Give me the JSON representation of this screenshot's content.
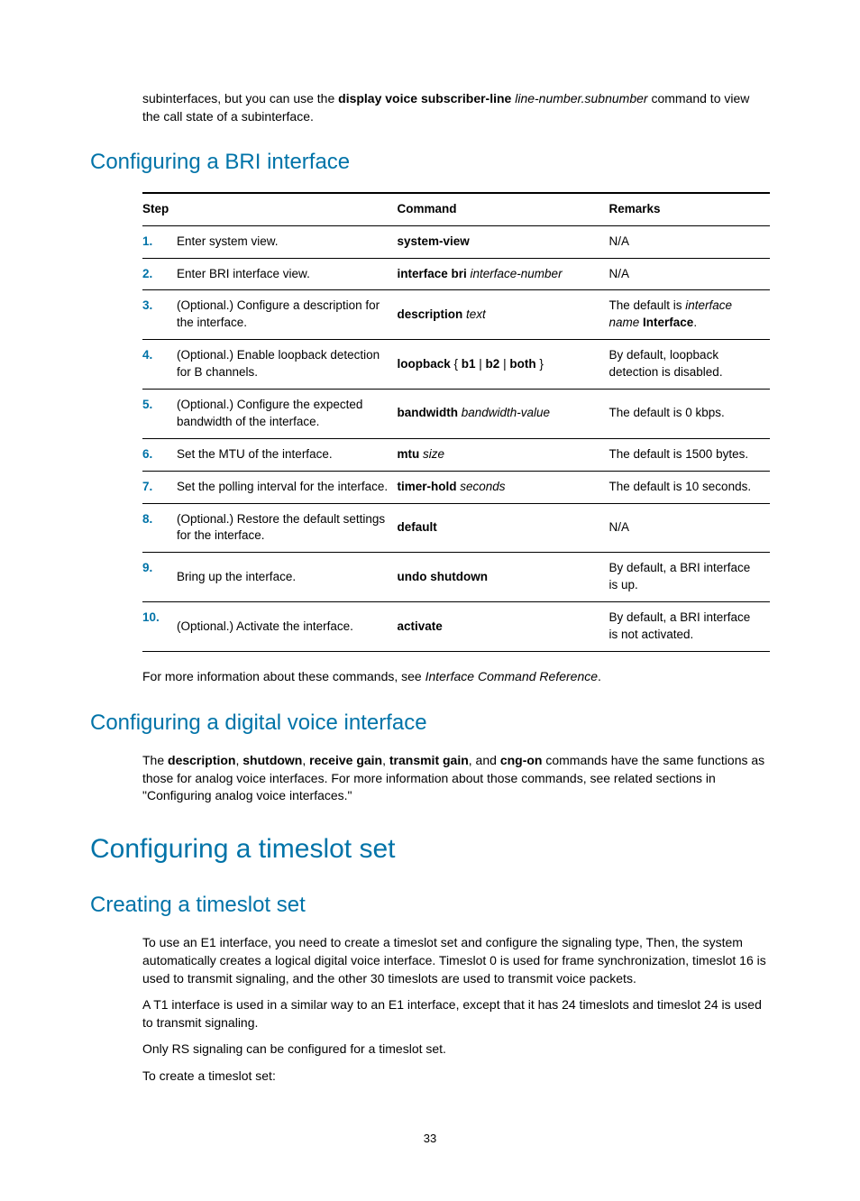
{
  "intro": {
    "pre": "subinterfaces, but you can use the ",
    "bold": "display voice subscriber-line ",
    "ital": "line-number.subnumber",
    "post": " command to view the call state of a subinterface."
  },
  "h_bri": "Configuring a BRI interface",
  "th": {
    "step": "Step",
    "cmd": "Command",
    "rem": "Remarks"
  },
  "rows": [
    {
      "n": "1.",
      "step": "Enter system view.",
      "cmd_b": "system-view",
      "cmd_i": "",
      "rem": "N/A",
      "rem_i": "",
      "rem2": ""
    },
    {
      "n": "2.",
      "step": "Enter BRI interface view.",
      "cmd_b": "interface bri ",
      "cmd_i": "interface-number",
      "rem": "N/A",
      "rem_i": "",
      "rem2": ""
    },
    {
      "n": "3.",
      "step": "(Optional.) Configure a description for the interface.",
      "cmd_b": "description ",
      "cmd_i": "text",
      "rem": "The default is ",
      "rem_i": "interface name",
      "rem2": " Interface.",
      "rem2_b": true
    },
    {
      "n": "4.",
      "step": "(Optional.) Enable loopback detection for B channels.",
      "cmd_b": "loopback",
      "cmd_i": "",
      "cmd_post": " { b1 | b2 | both }",
      "cmd_post_mixed": true,
      "rem": "By default, loopback detection is disabled.",
      "rem_i": "",
      "rem2": ""
    },
    {
      "n": "5.",
      "step": "(Optional.) Configure the expected bandwidth of the interface.",
      "cmd_b": "bandwidth ",
      "cmd_i": "bandwidth-value",
      "rem": "The default is 0 kbps.",
      "rem_i": "",
      "rem2": ""
    },
    {
      "n": "6.",
      "step": "Set the MTU of the interface.",
      "cmd_b": "mtu ",
      "cmd_i": "size",
      "rem": "The default is 1500 bytes.",
      "rem_i": "",
      "rem2": ""
    },
    {
      "n": "7.",
      "step": "Set the polling interval for the interface.",
      "cmd_b": "timer-hold ",
      "cmd_i": "seconds",
      "rem": "The default is 10 seconds.",
      "rem_i": "",
      "rem2": ""
    },
    {
      "n": "8.",
      "step": "(Optional.) Restore the default settings for the interface.",
      "cmd_b": "default",
      "cmd_i": "",
      "rem": "N/A",
      "rem_i": "",
      "rem2": ""
    },
    {
      "n": "9.",
      "step": "Bring up the interface.",
      "cmd_b": "undo shutdown",
      "cmd_i": "",
      "rem": "By default, a BRI interface is up.",
      "rem_i": "",
      "rem2": ""
    },
    {
      "n": "10.",
      "step": "(Optional.) Activate the interface.",
      "cmd_b": "activate",
      "cmd_i": "",
      "rem": "By default, a BRI interface is not activated.",
      "rem_i": "",
      "rem2": ""
    }
  ],
  "after_table": {
    "pre": "For more information about these commands, see ",
    "ital": "Interface Command Reference",
    "post": "."
  },
  "h_dvi": "Configuring a digital voice interface",
  "dvi_para": {
    "p0": "The ",
    "b1": "description",
    "c1": ", ",
    "b2": "shutdown",
    "c2": ", ",
    "b3": "receive gain",
    "c3": ", ",
    "b4": "transmit gain",
    "c4": ", and ",
    "b5": "cng-on",
    "post": " commands have the same functions as those for analog voice interfaces. For more information about those commands, see related sections in \"Configuring analog voice interfaces.\""
  },
  "h_ts": "Configuring a timeslot set",
  "h_cts": "Creating a timeslot set",
  "cts_p1": "To use an E1 interface, you need to create a timeslot set and configure the signaling type, Then, the system automatically creates a logical digital voice interface. Timeslot 0 is used for frame synchronization, timeslot 16 is used to transmit signaling, and the other 30 timeslots are used to transmit voice packets.",
  "cts_p2": "A T1 interface is used in a similar way to an E1 interface, except that it has 24 timeslots and timeslot 24 is used to transmit signaling.",
  "cts_p3": "Only RS signaling can be configured for a timeslot set.",
  "cts_p4": "To create a timeslot set:",
  "page": "33"
}
